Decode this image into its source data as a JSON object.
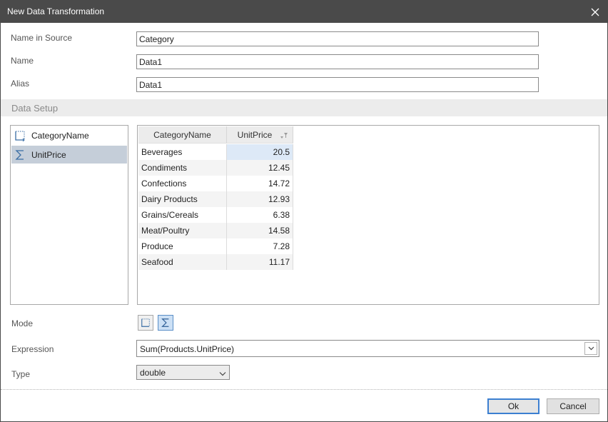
{
  "window": {
    "title": "New Data Transformation"
  },
  "fields": {
    "name_in_source": {
      "label": "Name in Source",
      "value": "Category"
    },
    "name": {
      "label": "Name",
      "value": "Data1"
    },
    "alias": {
      "label": "Alias",
      "value": "Data1"
    }
  },
  "section": {
    "title": "Data Setup"
  },
  "columns_list": {
    "items": [
      {
        "label": "CategoryName",
        "icon": "dimension-icon",
        "selected": false
      },
      {
        "label": "UnitPrice",
        "icon": "sum-icon",
        "selected": true
      }
    ]
  },
  "grid": {
    "headers": [
      "CategoryName",
      "UnitPrice"
    ],
    "rows": [
      {
        "name": "Beverages",
        "value": "20.5"
      },
      {
        "name": "Condiments",
        "value": "12.45"
      },
      {
        "name": "Confections",
        "value": "14.72"
      },
      {
        "name": "Dairy Products",
        "value": "12.93"
      },
      {
        "name": "Grains/Cereals",
        "value": "6.38"
      },
      {
        "name": "Meat/Poultry",
        "value": "14.58"
      },
      {
        "name": "Produce",
        "value": "7.28"
      },
      {
        "name": "Seafood",
        "value": "11.17"
      }
    ]
  },
  "mode": {
    "label": "Mode",
    "active": "summary"
  },
  "expression": {
    "label": "Expression",
    "value": "Sum(Products.UnitPrice)"
  },
  "type": {
    "label": "Type",
    "value": "double"
  },
  "buttons": {
    "ok": "Ok",
    "cancel": "Cancel"
  },
  "colors": {
    "titlebar": "#4a4a4a",
    "selection": "#c5ced9",
    "accent": "#3c7fd1",
    "focus_cell": "#dde9f7"
  }
}
